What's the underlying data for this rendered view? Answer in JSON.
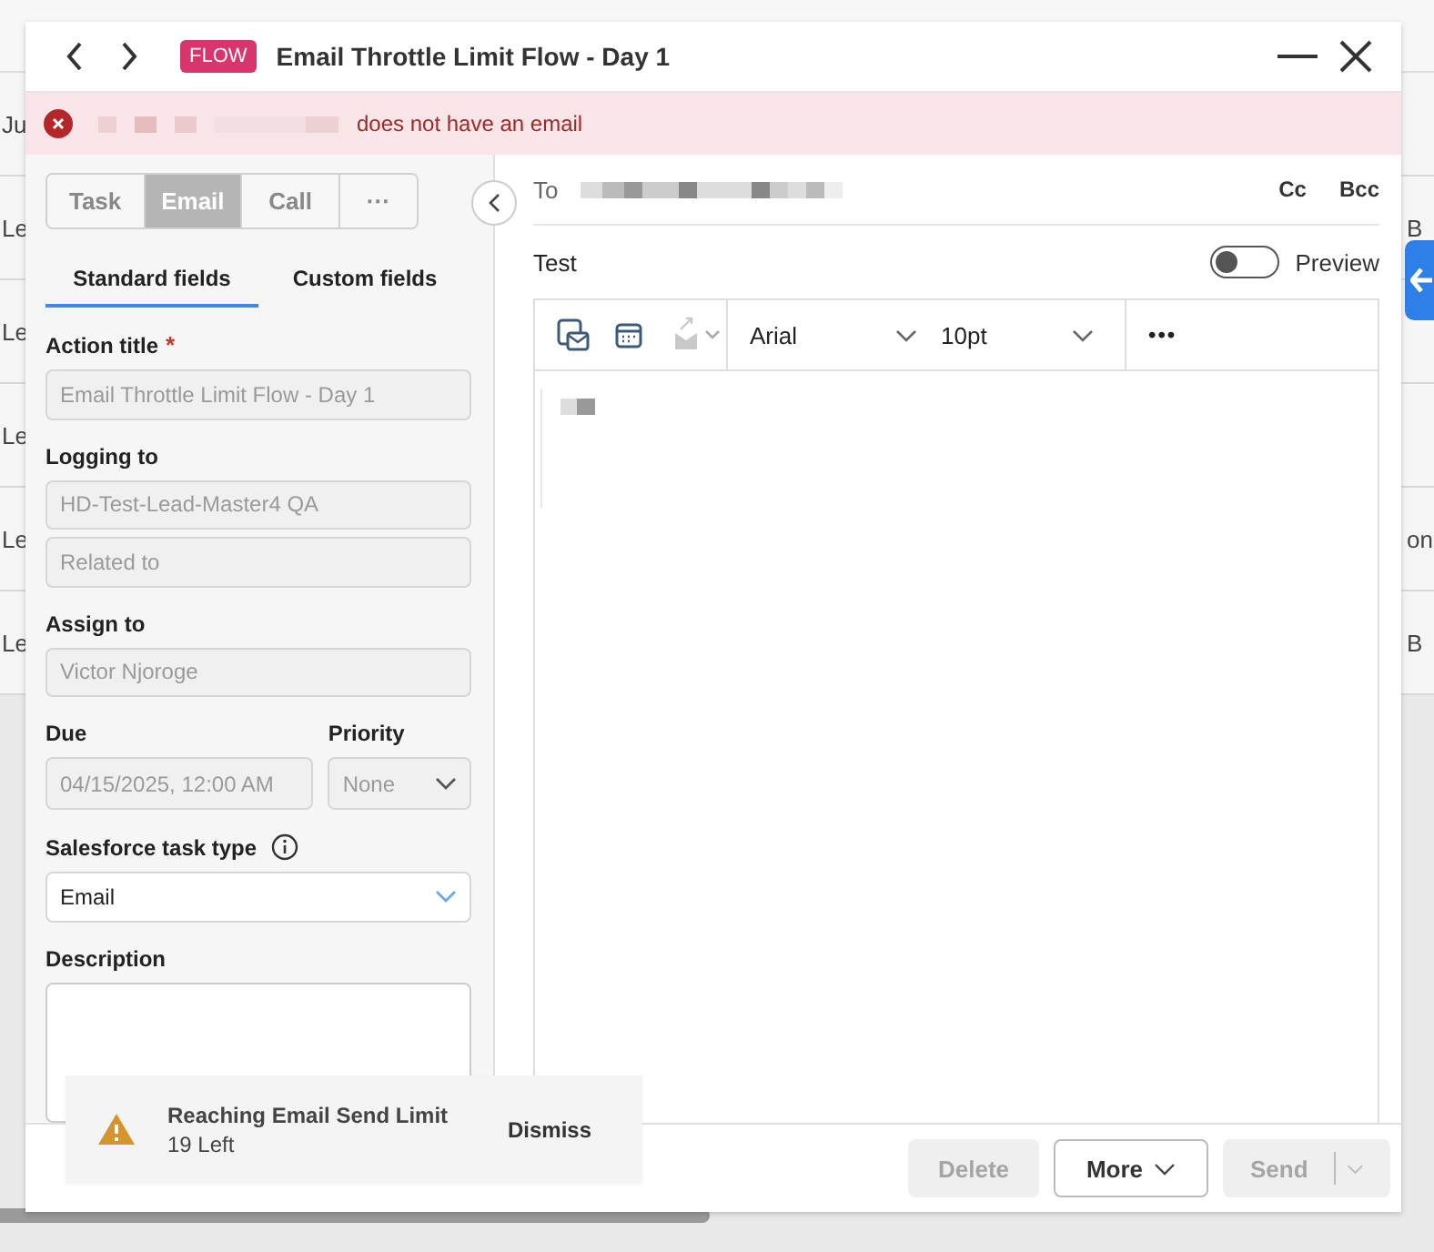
{
  "background": {
    "rows": [
      {
        "left": "Ju"
      },
      {
        "left": "Le",
        "right": "B"
      },
      {
        "left": "Le"
      },
      {
        "left": "Le"
      },
      {
        "left": "Le",
        "right": "on"
      },
      {
        "left": "Le",
        "right": "B"
      }
    ]
  },
  "window": {
    "badge": "FLOW",
    "title": "Email Throttle Limit Flow - Day 1"
  },
  "alert": {
    "message": "does not have an email"
  },
  "mode_tabs": [
    {
      "label": "Task",
      "selected": false
    },
    {
      "label": "Email",
      "selected": true
    },
    {
      "label": "Call",
      "selected": false
    },
    {
      "label": "···",
      "selected": false
    }
  ],
  "field_tabs": [
    {
      "label": "Standard fields",
      "selected": true
    },
    {
      "label": "Custom fields",
      "selected": false
    }
  ],
  "form": {
    "action_title": {
      "label": "Action title",
      "required_mark": "*",
      "value": "Email Throttle Limit Flow - Day 1",
      "disabled": true
    },
    "logging_to": {
      "label": "Logging to",
      "value": "HD-Test-Lead-Master4 QA",
      "disabled": true
    },
    "related_to": {
      "placeholder": "Related to",
      "disabled": true
    },
    "assign_to": {
      "label": "Assign to",
      "value": "Victor Njoroge",
      "disabled": true
    },
    "due": {
      "label": "Due",
      "value": "04/15/2025, 12:00 AM",
      "disabled": true
    },
    "priority": {
      "label": "Priority",
      "value": "None",
      "disabled": true
    },
    "task_type": {
      "label": "Salesforce task type",
      "value": "Email"
    },
    "description": {
      "label": "Description"
    }
  },
  "email": {
    "to_label": "To",
    "cc": "Cc",
    "bcc": "Bcc",
    "subject": "Test",
    "preview": {
      "label": "Preview",
      "on": false
    },
    "font": "Arial",
    "size": "10pt",
    "more": "•••"
  },
  "footer": {
    "delete": {
      "label": "Delete",
      "disabled": true
    },
    "more": "More",
    "send": {
      "label": "Send",
      "disabled": true
    }
  },
  "toast": {
    "title": "Reaching Email Send Limit",
    "detail": "19 Left",
    "action": "Dismiss"
  }
}
